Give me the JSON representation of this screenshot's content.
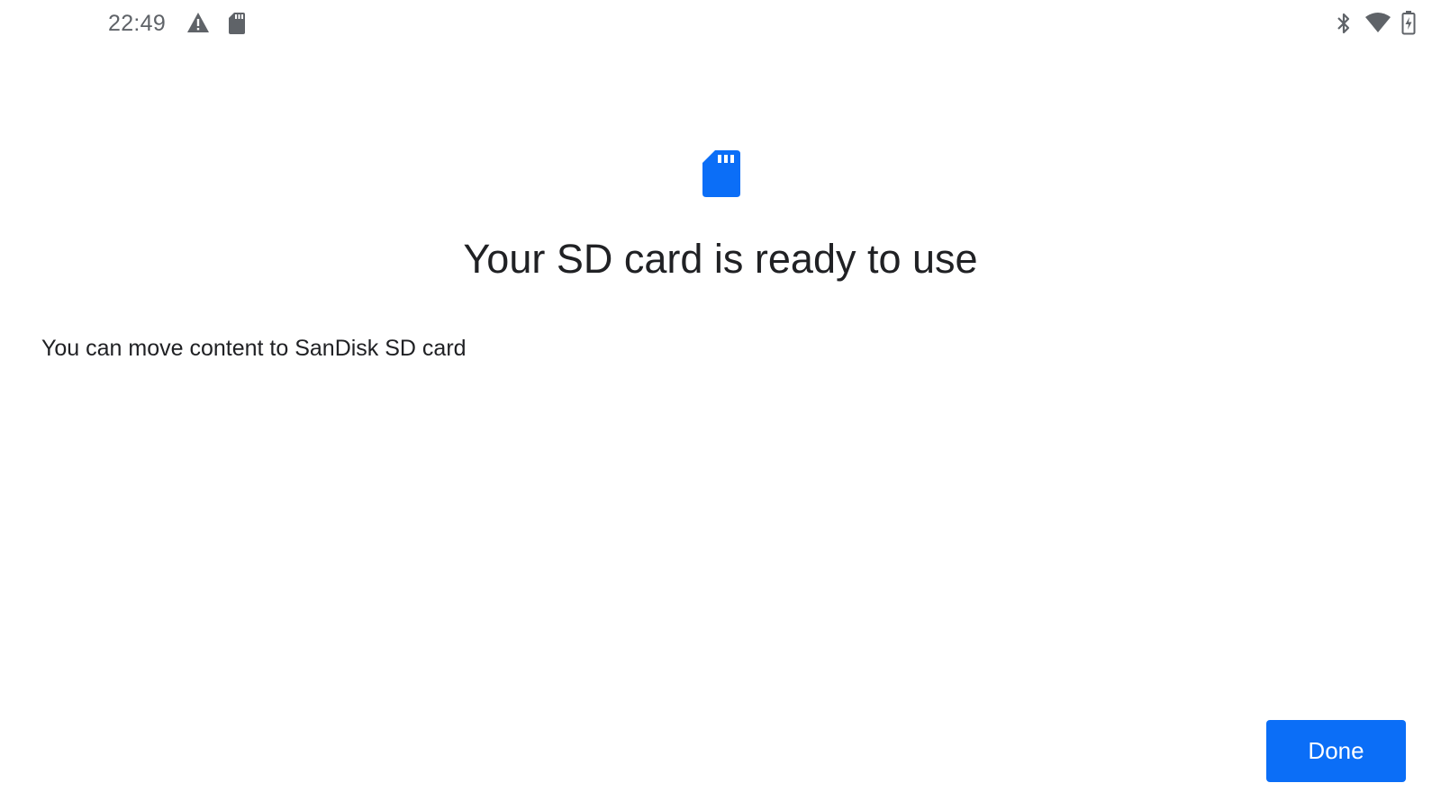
{
  "status_bar": {
    "time": "22:49",
    "icons": [
      "warning-icon",
      "sd-card-icon",
      "bluetooth-icon",
      "wifi-icon",
      "battery-charging-icon"
    ],
    "icon_color": "#5f6368"
  },
  "main": {
    "hero_icon": "sd-card-icon",
    "accent_color": "#0b6ef7",
    "title": "Your SD card is ready to use",
    "body": "You can move content to SanDisk SD card"
  },
  "actions": {
    "done_label": "Done"
  }
}
